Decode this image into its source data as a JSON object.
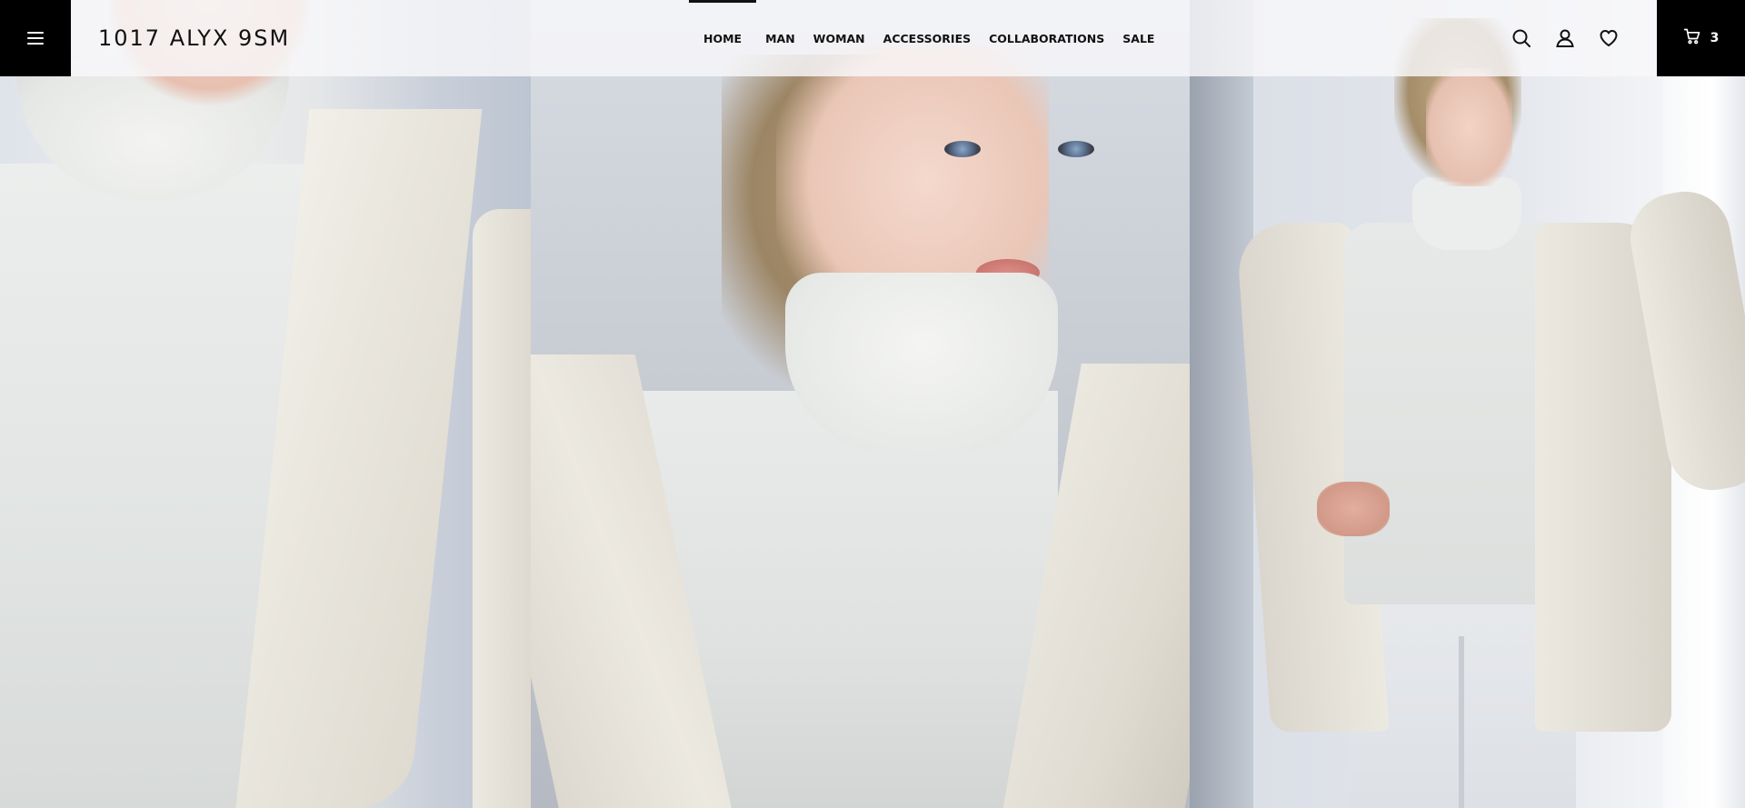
{
  "header": {
    "menu_icon": "hamburger-menu-icon",
    "logo": "1017 ALYX 9SM",
    "nav": [
      {
        "label": "HOME",
        "active": true
      },
      {
        "label": "MAN",
        "active": false
      },
      {
        "label": "WOMAN",
        "active": false
      },
      {
        "label": "ACCESSORIES",
        "active": false
      },
      {
        "label": "COLLABORATIONS",
        "active": false
      },
      {
        "label": "SALE",
        "active": false
      }
    ],
    "actions": [
      {
        "icon": "search-icon"
      },
      {
        "icon": "user-icon"
      },
      {
        "icon": "heart-icon"
      }
    ],
    "cart": {
      "icon": "cart-icon",
      "count": "3"
    }
  },
  "hero": {
    "panels": [
      "left-closeup-turtleneck",
      "center-portrait",
      "right-full-body"
    ]
  },
  "colors": {
    "header_bg": "#f8f8fa",
    "accent": "#000000",
    "text": "#111111"
  }
}
